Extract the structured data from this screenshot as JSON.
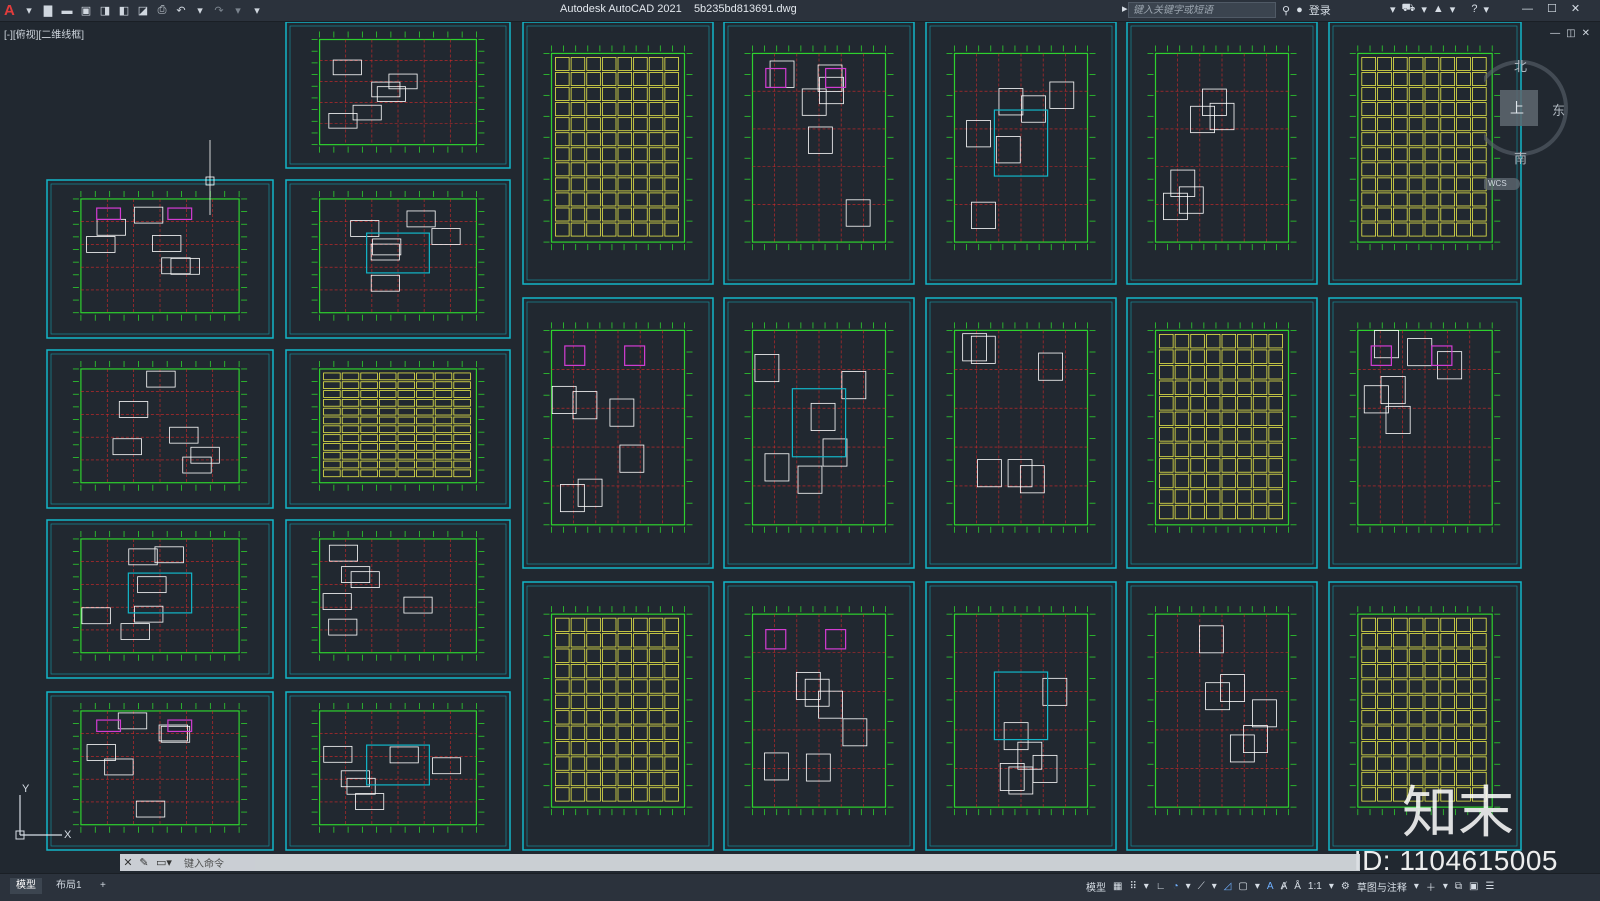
{
  "app": {
    "title": "Autodesk AutoCAD 2021",
    "filename": "5b235bd813691.dwg"
  },
  "search": {
    "placeholder": "键入关键字或短语"
  },
  "login": {
    "label": "登录"
  },
  "viewport": {
    "label": "[-][俯视][二维线框]"
  },
  "navcube": {
    "north": "北",
    "east": "东",
    "south": "南",
    "top": "上",
    "wcs": "WCS"
  },
  "cmd": {
    "placeholder": "键入命令"
  },
  "tabs": [
    {
      "label": "模型",
      "active": true
    },
    {
      "label": "布局1",
      "active": false
    }
  ],
  "status": {
    "model_label": "模型",
    "scale": "1:1",
    "workspace": "草图与注释"
  },
  "ucs": {
    "y": "Y",
    "x": "X"
  },
  "watermark": {
    "id": "ID: 1104615005",
    "brand": "知末"
  },
  "colors": {
    "background": "#212830",
    "sheet_border": "#12b6c8",
    "lines": "#2ed12e",
    "highlight": "#e8e84a",
    "magenta": "#d23cd2",
    "red": "#d22a2a"
  },
  "icons": [
    "app-logo",
    "new-icon",
    "open-icon",
    "save-icon",
    "saveas-icon",
    "plot-icon",
    "undo-icon",
    "redo-icon",
    "search-icon",
    "user-icon",
    "cart-icon",
    "help-icon",
    "minimize-icon",
    "maximize-icon",
    "close-icon"
  ]
}
